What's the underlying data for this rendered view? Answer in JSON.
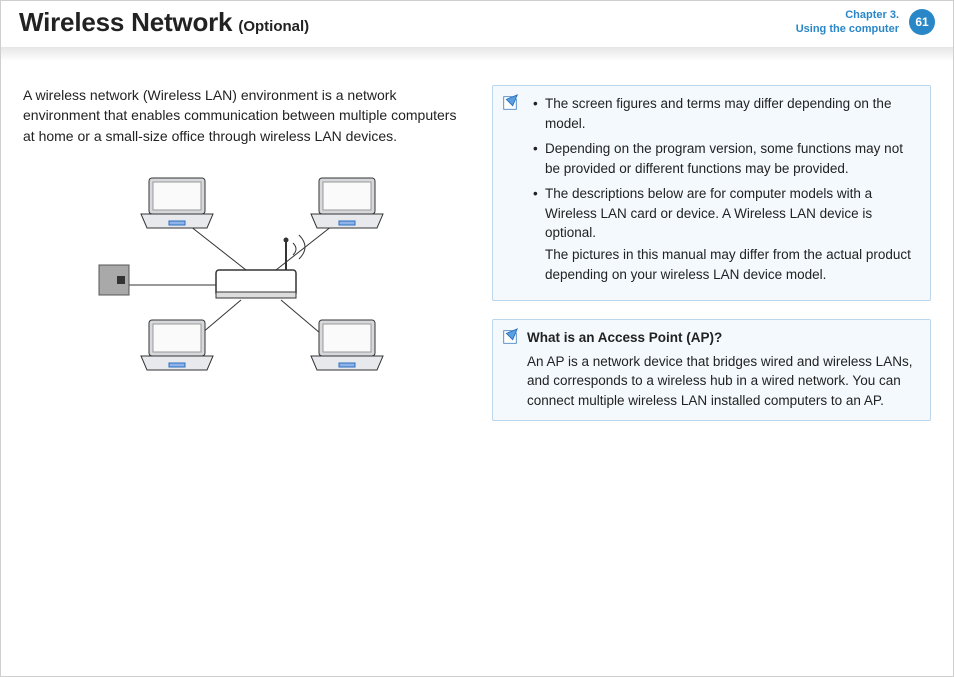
{
  "header": {
    "title_main": "Wireless Network",
    "title_sub": "(Optional)",
    "chapter_line1": "Chapter 3.",
    "chapter_line2": "Using the computer",
    "page_number": "61"
  },
  "intro": "A wireless network (Wireless LAN) environment is a network environment that enables communication between multiple computers at home or a small-size office through wireless LAN devices.",
  "diagram": {
    "label": "wireless-lan-diagram"
  },
  "notes": {
    "items": [
      {
        "text": "The screen figures and terms may differ depending on the model."
      },
      {
        "text": "Depending on the program version, some functions may not be provided or different functions may be provided."
      },
      {
        "text": "The descriptions below are for computer models with a Wireless LAN card or device. A Wireless LAN device is optional.",
        "text2": "The pictures in this manual may differ from the actual product depending on your wireless LAN device model."
      }
    ]
  },
  "qa": {
    "title": "What is an Access Point (AP)?",
    "body": "An AP is a network device that bridges wired and wireless LANs, and corresponds to a wireless hub in a wired network. You can connect multiple wireless LAN installed computers to an AP."
  }
}
